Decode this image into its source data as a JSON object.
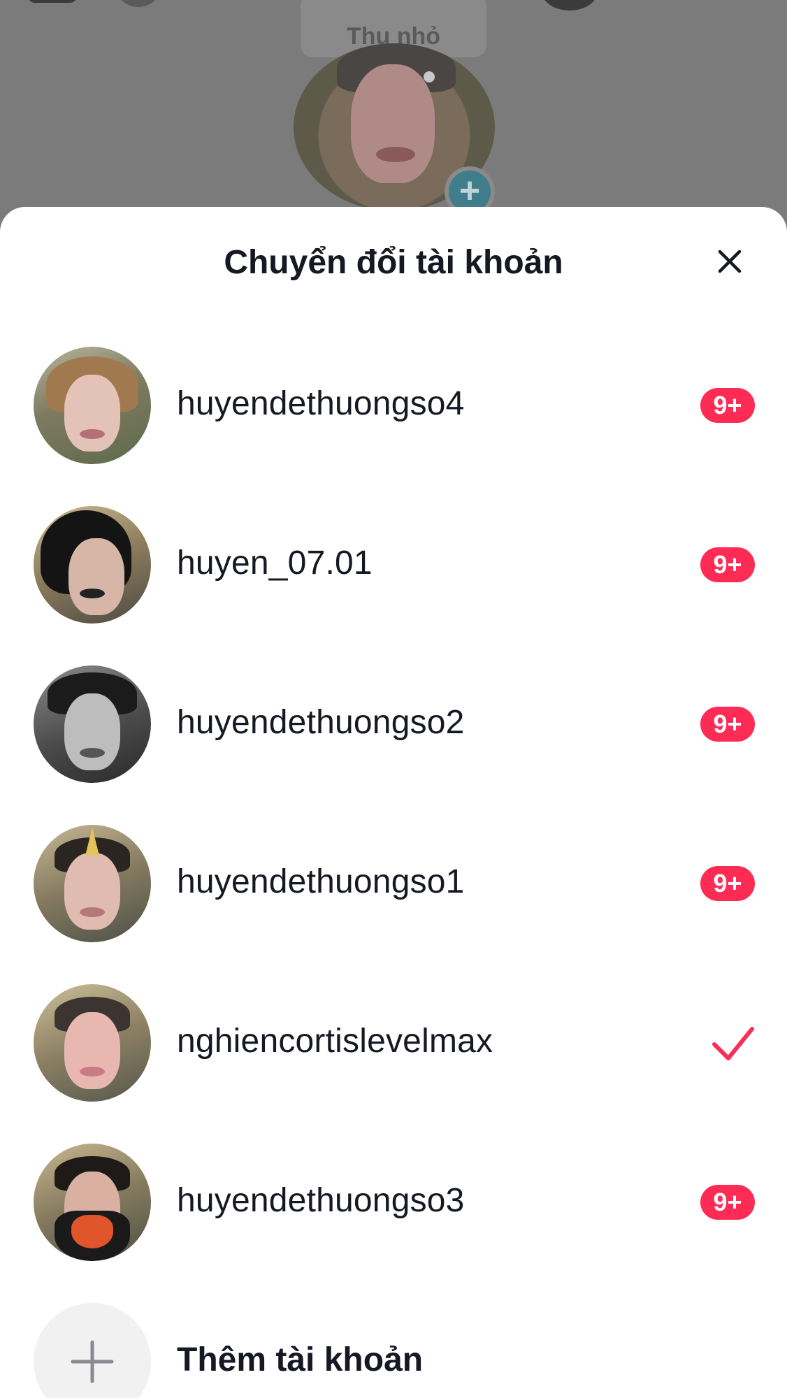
{
  "background": {
    "tooltip_text": "Thu nhỏ",
    "tooltip_text_full": "Thu nhỏ"
  },
  "sheet": {
    "title": "Chuyển đổi tài khoản",
    "close_icon": "close-icon"
  },
  "accounts": [
    {
      "username": "huyendethuongso4",
      "badge": "9+",
      "selected": false
    },
    {
      "username": "huyen_07.01",
      "badge": "9+",
      "selected": false
    },
    {
      "username": "huyendethuongso2",
      "badge": "9+",
      "selected": false
    },
    {
      "username": "huyendethuongso1",
      "badge": "9+",
      "selected": false
    },
    {
      "username": "nghiencortislevelmax",
      "badge": "",
      "selected": true
    },
    {
      "username": "huyendethuongso3",
      "badge": "9+",
      "selected": false
    }
  ],
  "add_account": {
    "label": "Thêm tài khoản",
    "icon": "plus-icon"
  },
  "colors": {
    "accent": "#fe2c55",
    "text": "#161823",
    "sheet_bg": "#ffffff",
    "backdrop": "#7b7b7b"
  }
}
